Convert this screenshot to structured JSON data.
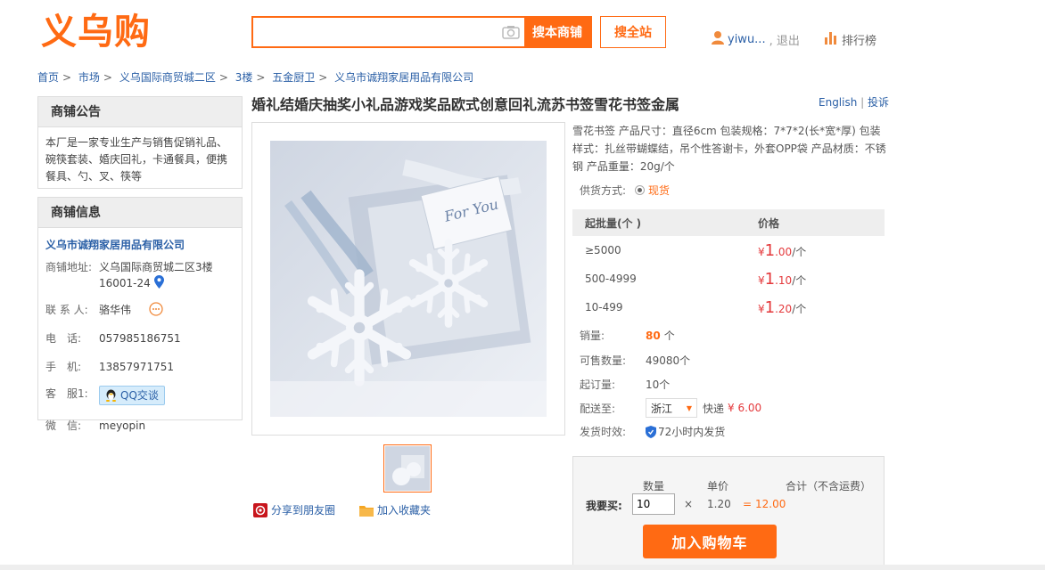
{
  "header": {
    "logo": "义乌购",
    "search_placeholder": "",
    "search_store_label": "搜本商铺",
    "search_site_label": "搜全站",
    "username": "yiwu...",
    "logout_label": ", 退出",
    "ranking_label": "排行榜"
  },
  "breadcrumb": [
    "首页",
    "市场",
    "义乌国际商贸城二区",
    "3楼",
    "五金厨卫",
    "义乌市诚翔家居用品有限公司"
  ],
  "notice": {
    "title": "商铺公告",
    "text": "本厂是一家专业生产与销售促销礼品、碗筷套装、婚庆回礼，卡通餐具，便携餐具、勺、叉、筷等"
  },
  "shop_info": {
    "title": "商铺信息",
    "company": "义乌市诚翔家居用品有限公司",
    "address_label": "商铺地址:",
    "address_line1": "义乌国际商贸城二区3楼",
    "address_line2": "16001-24",
    "contact_label": "联 系 人:",
    "contact": "骆华伟",
    "phone_label": "电　话:",
    "phone": "057985186751",
    "mobile_label": "手　机:",
    "mobile": "13857971751",
    "service_label": "客　服1:",
    "qq_label": "QQ交谈",
    "wechat_label": "微　信:",
    "wechat": "meyopin"
  },
  "product": {
    "title": "婚礼结婚庆抽奖小礼品游戏奖品欧式创意回礼流苏书签雪花书签金属",
    "english_link": "English",
    "complaint_link": "投诉",
    "description": "雪花书签 产品尺寸：直径6cm 包装规格：7*7*2(长*宽*厚) 包装样式：扎丝带蝴蝶结，吊个性答谢卡，外套OPP袋 产品材质：不锈钢 产品重量：20g/个",
    "card_text": "For You",
    "supply_label": "供货方式:",
    "supply_option": "现货",
    "price_header_qty": "起批量(个 )",
    "price_header_price": "价格",
    "price_tiers": [
      {
        "qty": "≥5000",
        "currency": "¥",
        "int": "1",
        "dec": ".00",
        "unit": "/个"
      },
      {
        "qty": "500-4999",
        "currency": "¥",
        "int": "1",
        "dec": ".10",
        "unit": "/个"
      },
      {
        "qty": "10-499",
        "currency": "¥",
        "int": "1",
        "dec": ".20",
        "unit": "/个"
      }
    ],
    "sales_label": "销量:",
    "sales_value": "80",
    "sales_unit": "个",
    "stock_label": "可售数量:",
    "stock_value": "49080个",
    "moq_label": "起订量:",
    "moq_value": "10个",
    "ship_label": "配送至:",
    "ship_province": "浙江",
    "ship_method": "快递",
    "ship_fee": "¥ 6.00",
    "delivery_label": "发货时效:",
    "delivery_value": "72小时内发货",
    "share_label": "分享到朋友圈",
    "fav_label": "加入收藏夹"
  },
  "buy": {
    "qty_header": "数量",
    "unit_header": "单价",
    "total_header": "合计（不含运费）",
    "buy_label": "我要买:",
    "qty_value": "10",
    "times": "×",
    "unit_price": "1.20",
    "equals": "=",
    "total": "12.00",
    "cart_label": "加入购物车"
  },
  "colors": {
    "accent": "#ff6a13",
    "link": "#2a5fa6",
    "price": "#e4393c"
  }
}
